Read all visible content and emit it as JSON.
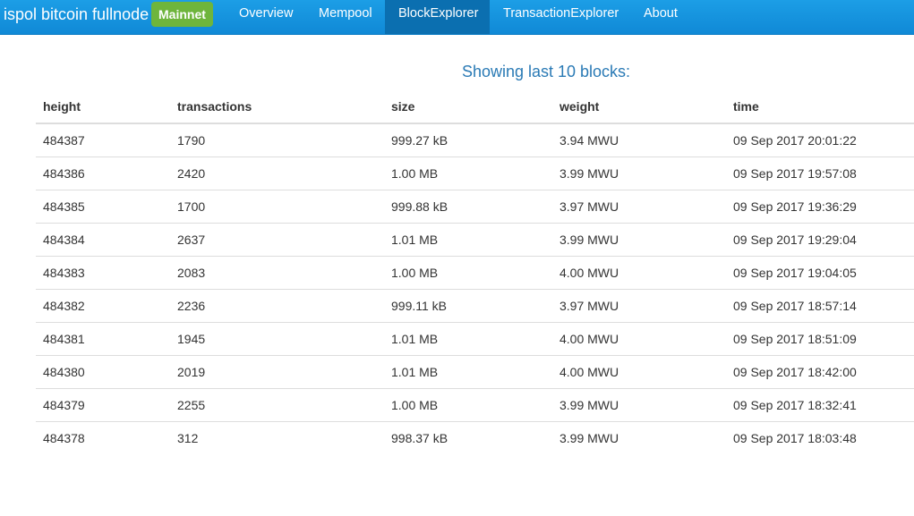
{
  "navbar": {
    "brand": "ispol bitcoin fullnode",
    "network_badge": "Mainnet",
    "items": [
      {
        "label": "Overview",
        "active": false
      },
      {
        "label": "Mempool",
        "active": false
      },
      {
        "label": "BlockExplorer",
        "active": true
      },
      {
        "label": "TransactionExplorer",
        "active": false
      },
      {
        "label": "About",
        "active": false
      }
    ],
    "colors": {
      "bar": "#1a96e0",
      "active": "#0b6fb0",
      "badge": "#6eb53c"
    }
  },
  "main": {
    "heading": "Showing last 10 blocks:",
    "table": {
      "columns": [
        "height",
        "transactions",
        "size",
        "weight",
        "time"
      ],
      "rows": [
        [
          "484387",
          "1790",
          "999.27 kB",
          "3.94 MWU",
          "09 Sep 2017 20:01:22"
        ],
        [
          "484386",
          "2420",
          "1.00 MB",
          "3.99 MWU",
          "09 Sep 2017 19:57:08"
        ],
        [
          "484385",
          "1700",
          "999.88 kB",
          "3.97 MWU",
          "09 Sep 2017 19:36:29"
        ],
        [
          "484384",
          "2637",
          "1.01 MB",
          "3.99 MWU",
          "09 Sep 2017 19:29:04"
        ],
        [
          "484383",
          "2083",
          "1.00 MB",
          "4.00 MWU",
          "09 Sep 2017 19:04:05"
        ],
        [
          "484382",
          "2236",
          "999.11 kB",
          "3.97 MWU",
          "09 Sep 2017 18:57:14"
        ],
        [
          "484381",
          "1945",
          "1.01 MB",
          "4.00 MWU",
          "09 Sep 2017 18:51:09"
        ],
        [
          "484380",
          "2019",
          "1.01 MB",
          "4.00 MWU",
          "09 Sep 2017 18:42:00"
        ],
        [
          "484379",
          "2255",
          "1.00 MB",
          "3.99 MWU",
          "09 Sep 2017 18:32:41"
        ],
        [
          "484378",
          "312",
          "998.37 kB",
          "3.99 MWU",
          "09 Sep 2017 18:03:48"
        ]
      ]
    }
  }
}
